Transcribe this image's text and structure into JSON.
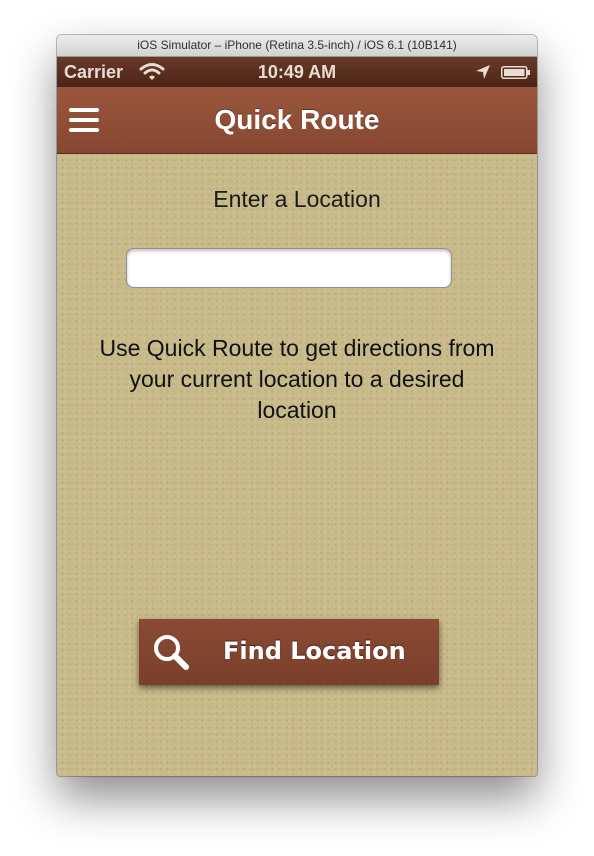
{
  "window": {
    "title": "iOS Simulator – iPhone (Retina 3.5-inch) / iOS 6.1 (10B141)"
  },
  "status_bar": {
    "carrier": "Carrier",
    "time": "10:49 AM",
    "icons": [
      "wifi-icon",
      "location-arrow-icon",
      "battery-icon"
    ]
  },
  "nav_bar": {
    "title": "Quick Route",
    "menu_icon": "hamburger-menu-icon"
  },
  "main": {
    "enter_label": "Enter a Location",
    "location_input": {
      "value": "",
      "placeholder": ""
    },
    "description": "Use Quick Route to get directions from your current location to a desired location",
    "find_button": {
      "label": "Find Location",
      "icon": "search-icon"
    }
  },
  "colors": {
    "nav_bar": "#8f4f36",
    "status_bar": "#5a2e1e",
    "background": "#c8b988",
    "button": "#7f432e",
    "text": "#1a1a1a"
  }
}
